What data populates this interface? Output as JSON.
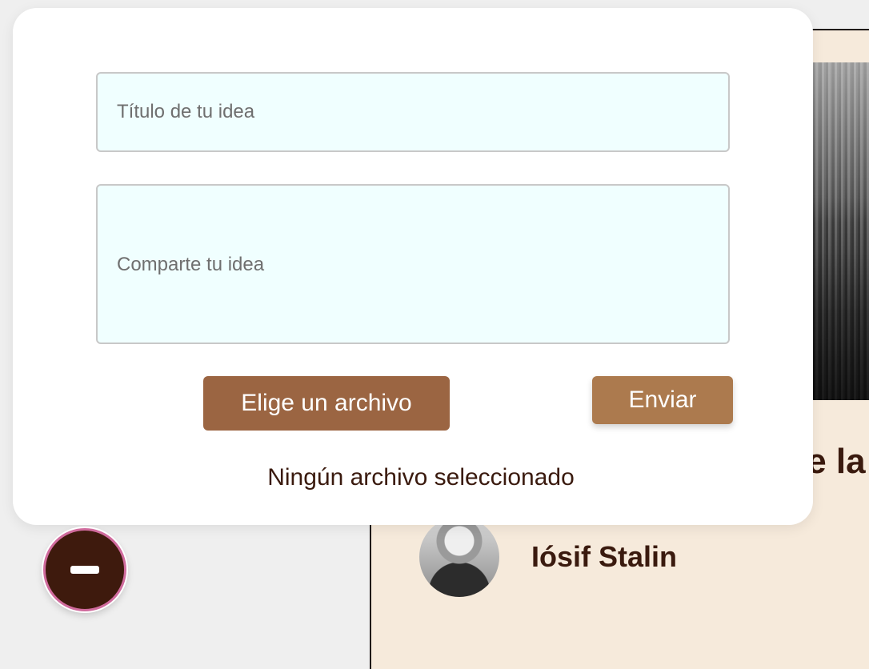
{
  "form": {
    "title_placeholder": "Título de tu idea",
    "idea_placeholder": "Comparte tu idea",
    "choose_file_label": "Elige un archivo",
    "send_label": "Enviar",
    "file_status": "Ningún archivo seleccionado"
  },
  "background_post": {
    "heading_fragment": "le la",
    "author_name": "Iósif Stalin"
  },
  "fab": {
    "icon": "minus-icon"
  },
  "colors": {
    "modal_bg": "#ffffff",
    "input_bg": "#f0ffff",
    "choose_button": "#9b6542",
    "send_button": "#ac7a4e",
    "text_brown": "#3a1a0e",
    "fab_bg": "#3e1a0d",
    "fab_ring": "#d06b9d",
    "card_bg": "#f6eadb"
  }
}
